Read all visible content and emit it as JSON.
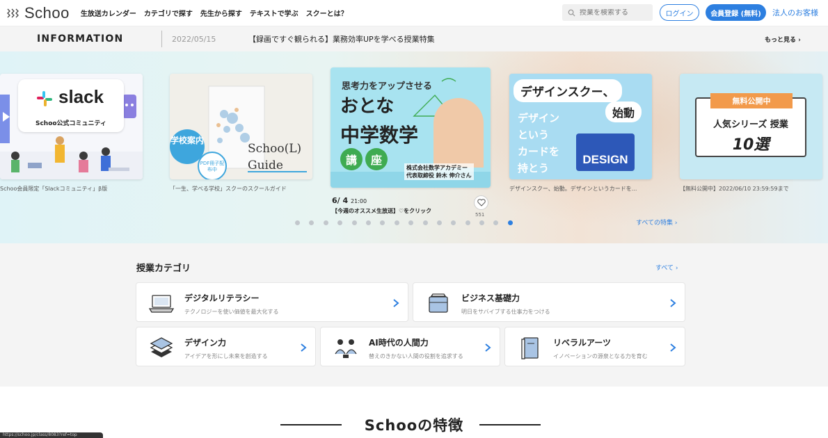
{
  "header": {
    "logo_text": "Schoo",
    "nav": [
      "生放送カレンダー",
      "カテゴリで探す",
      "先生から探す",
      "テキストで学ぶ",
      "スクーとは？"
    ],
    "search_placeholder": "授業を検索する",
    "login_label": "ログイン",
    "register_label": "会員登録 (無料)",
    "corporate_label": "法人のお客様",
    "accent_color": "#2d7fe0"
  },
  "info": {
    "label": "INFORMATION",
    "date": "2022/05/15",
    "text": "【録画ですぐ観られる】業務効率UPを学べる授業特集",
    "more_label": "もっと見る"
  },
  "carousel": {
    "slides": [
      {
        "caption": "Schoo会員限定「Slackコミュニティ」β版",
        "brand": "slack",
        "subtitle": "Schoo公式コミュニティ"
      },
      {
        "caption": "「一生、学べる学校」スクーのスクールガイド",
        "badge": "学校案内",
        "badge_sub": "PDF冊子配布中",
        "guide_line1": "Schoo(L)",
        "guide_line2": "Guide"
      },
      {
        "top_text": "思考力をアップさせる",
        "title1": "おとな",
        "title2": "中学数学",
        "koza": [
          "講",
          "座"
        ],
        "teacher_line1": "株式会社数学アカデミー",
        "teacher_line2": "代表取締役 鈴木 伸介さん",
        "date": "6/ 4",
        "time": "21:00",
        "promo": "【今週のオススメ生放送】♡をクリック",
        "like_count": "551"
      },
      {
        "caption": "デザインスクー、始動。デザインというカードを...",
        "title": "デザインスクー、",
        "title2": "始動",
        "lines": [
          "デザイン",
          "という",
          "カードを",
          "持とう"
        ],
        "badge": "DESIGN"
      },
      {
        "caption": "【無料公開中】2022/06/10 23:59:59まで",
        "tag": "無料公開中",
        "series": "人気シリーズ 授業",
        "count": "10選"
      }
    ],
    "dot_count": 16,
    "active_dot": 15,
    "all_features_label": "すべての特集"
  },
  "categories": {
    "title": "授業カテゴリ",
    "all_label": "すべて",
    "items": [
      {
        "name": "デジタルリテラシー",
        "desc": "テクノロジーを使い価値を最大化する",
        "icon": "laptop-icon"
      },
      {
        "name": "ビジネス基礎力",
        "desc": "明日をサバイブする仕事力をつける",
        "icon": "briefcase-icon"
      },
      {
        "name": "デザイン力",
        "desc": "アイデアを形にし未来を創造する",
        "icon": "design-stack-icon"
      },
      {
        "name": "AI時代の人間力",
        "desc": "替えのきかない人間の役割を追求する",
        "icon": "people-icon"
      },
      {
        "name": "リベラルアーツ",
        "desc": "イノベーションの源泉となる力を育む",
        "icon": "book-icon"
      }
    ]
  },
  "features": {
    "title": "Schooの特徴"
  },
  "status_bar": {
    "url": "https://schoo.jp/class/8083?ref=top"
  }
}
